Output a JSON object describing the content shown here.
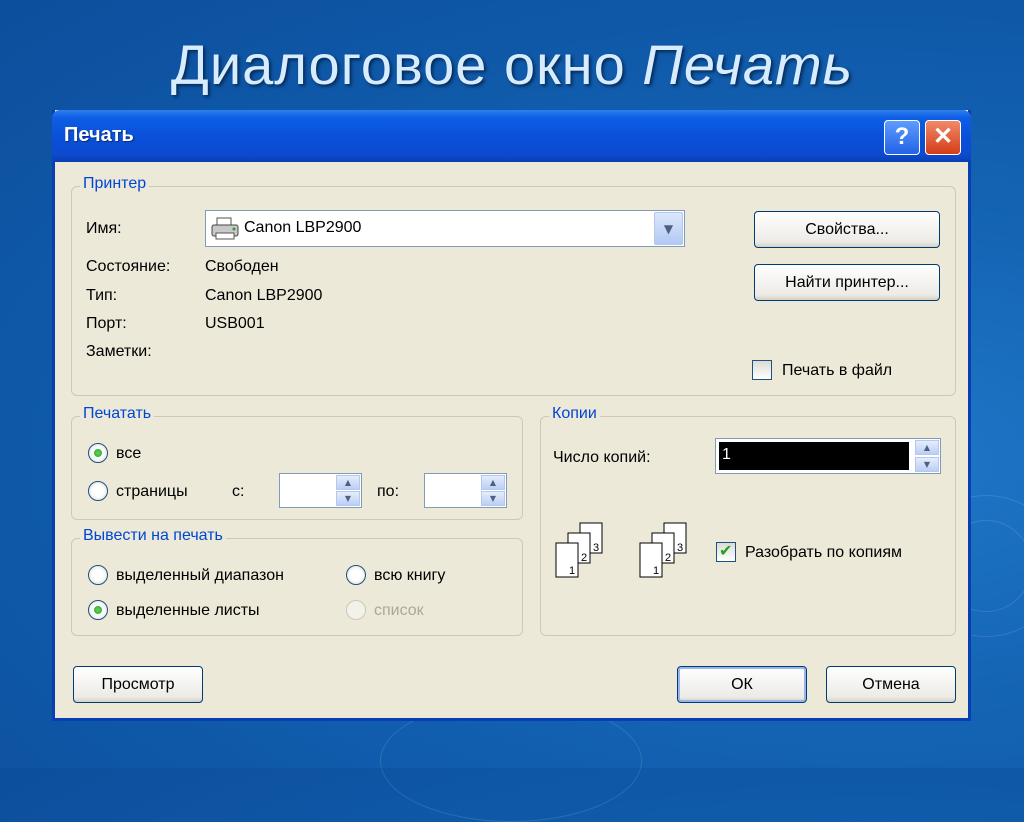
{
  "slide": {
    "title_plain": "Диалоговое окно ",
    "title_italic": "Печать"
  },
  "dialog": {
    "title": "Печать",
    "help_label": "?",
    "close_label": "✕"
  },
  "printer": {
    "legend": "Принтер",
    "name_label": "Имя:",
    "name_value": "Canon LBP2900",
    "status_label": "Состояние:",
    "status_value": "Свободен",
    "type_label": "Тип:",
    "type_value": "Canon LBP2900",
    "port_label": "Порт:",
    "port_value": "USB001",
    "notes_label": "Заметки:",
    "properties_button": "Свойства...",
    "find_printer_button": "Найти принтер...",
    "print_to_file_label": "Печать в файл",
    "print_to_file_checked": false
  },
  "print_range": {
    "legend": "Печатать",
    "all_label": "все",
    "all_selected": true,
    "pages_label": "страницы",
    "from_label": "с:",
    "to_label": "по:",
    "from_value": "",
    "to_value": ""
  },
  "print_what": {
    "legend": "Вывести на печать",
    "selection_label": "выделенный диапазон",
    "workbook_label": "всю книгу",
    "active_sheets_label": "выделенные листы",
    "active_sheets_selected": true,
    "list_label": "список"
  },
  "copies": {
    "legend": "Копии",
    "number_label": "Число копий:",
    "number_value": "1",
    "collate_label": "Разобрать по копиям",
    "collate_checked": true,
    "page_numbers": [
      "1",
      "2",
      "3"
    ]
  },
  "footer": {
    "preview_button": "Просмотр",
    "ok_button": "ОК",
    "cancel_button": "Отмена"
  },
  "icons": {
    "printer": "printer-icon",
    "dropdown": "chevron-down-icon",
    "help": "help-icon",
    "close": "close-icon",
    "collate": "collated-pages-icon"
  },
  "colors": {
    "titlebar": "#0a4fd8",
    "dialog_bg": "#ece9d8",
    "legend_text": "#0046d5",
    "slide_bg": "#1565b5"
  }
}
